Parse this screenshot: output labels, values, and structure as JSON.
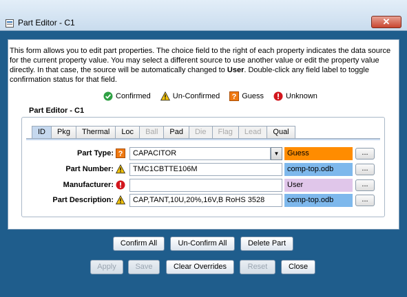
{
  "window": {
    "title": "Part Editor - C1",
    "close_label": "✕"
  },
  "description_parts": [
    "This form allows you to edit part properties. The choice field to the right of each property indicates the data source for the current property value. You may select a different source to use another value or edit the property value directly. In that case, the source will be automatically changed to ",
    "User",
    ". Double-click any field label to toggle confirmation status for that field."
  ],
  "legend": {
    "confirmed": "Confirmed",
    "unconfirmed": "Un-Confirmed",
    "guess": "Guess",
    "unknown": "Unknown"
  },
  "group_title": "Part Editor - C1",
  "tabs": [
    {
      "label": "ID",
      "state": "selected"
    },
    {
      "label": "Pkg",
      "state": "enabled"
    },
    {
      "label": "Thermal",
      "state": "enabled"
    },
    {
      "label": "Loc",
      "state": "enabled"
    },
    {
      "label": "Ball",
      "state": "disabled"
    },
    {
      "label": "Pad",
      "state": "enabled"
    },
    {
      "label": "Die",
      "state": "disabled"
    },
    {
      "label": "Flag",
      "state": "disabled"
    },
    {
      "label": "Lead",
      "state": "disabled"
    },
    {
      "label": "Qual",
      "state": "enabled"
    }
  ],
  "rows": [
    {
      "label": "Part Type:",
      "status": "guess",
      "value": "CAPACITOR",
      "source": "Guess",
      "source_color": "#ff8c00",
      "button": "..."
    },
    {
      "label": "Part Number:",
      "status": "unconfirmed",
      "value": "TMC1CBTTE106M",
      "source": "comp-top.odb",
      "source_color": "#7eb8ec",
      "button": "..."
    },
    {
      "label": "Manufacturer:",
      "status": "unknown",
      "value": "",
      "source": "User",
      "source_color": "#e0c6ea",
      "button": "..."
    },
    {
      "label": "Part Description:",
      "status": "unconfirmed",
      "value": "CAP,TANT,10U,20%,16V,B RoHS 3528",
      "source": "comp-top.odb",
      "source_color": "#7eb8ec",
      "button": "..."
    }
  ],
  "buttons": {
    "confirm_all": "Confirm All",
    "unconfirm_all": "Un-Confirm All",
    "delete_part": "Delete Part",
    "apply": "Apply",
    "save": "Save",
    "clear_overrides": "Clear Overrides",
    "reset": "Reset",
    "close": "Close"
  },
  "colors": {
    "frame": "#1f5d8c",
    "confirmed": "#2ea043",
    "unconfirmed": "#f2c20c",
    "guess": "#f07a12",
    "unknown": "#d2161d"
  }
}
